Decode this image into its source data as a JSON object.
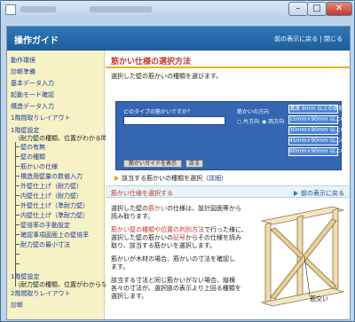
{
  "window": {
    "minimize_glyph": "–",
    "maximize_glyph": "□",
    "close_glyph": "✕"
  },
  "header": {
    "title": "操作ガイド",
    "back_link": "前の表示に戻る",
    "separator": "|",
    "close_link": "閉じる"
  },
  "sidebar": {
    "items": [
      {
        "label": "動作環境"
      },
      {
        "label": "診断準備"
      },
      {
        "label": "基本データ入力"
      },
      {
        "label": "起動モード確認"
      },
      {
        "label": "構造データ入力"
      },
      {
        "label": "1階間取りレイアウト"
      },
      {
        "label": "1階壁設定"
      },
      {
        "label": "（耐力壁の種類、位置がわかる時）"
      },
      {
        "label": "壁の有無"
      },
      {
        "label": "壁の種類"
      },
      {
        "label": "筋かいの仕様"
      },
      {
        "label": "構造用壁量の数値入力"
      },
      {
        "label": "外壁仕上げ（耐力壁）"
      },
      {
        "label": "内壁仕上げ（耐力壁）"
      },
      {
        "label": "外壁仕上げ（準耐力壁）"
      },
      {
        "label": "内壁仕上げ（準耐力壁）"
      },
      {
        "label": "壁倍率の手動設定"
      },
      {
        "label": "確認事項図面上の壁倍率"
      },
      {
        "label": "耐力壁の最小寸法"
      },
      {
        "label": "1階壁設定"
      },
      {
        "label": "（耐力壁の種類、位置がわからない時）"
      },
      {
        "label": "2階間取りレイアウト"
      },
      {
        "label": "診断"
      }
    ]
  },
  "main": {
    "section_title": "筋かい仕様の選択方法",
    "intro": "選択した壁の筋かいの種類を選びます。",
    "panel": {
      "question": "どのタイプの筋かいですか？",
      "direction_label": "筋かいの方向",
      "radio_one": "片方向",
      "radio_both": "両方向",
      "type_buttons": [
        "溝渡 9mm 以上の鉄筋",
        "15mm×90mm 以上の鉄筋",
        "30mm×90mm 以上の鉄筋",
        "45mm×90mm 以上の鉄筋",
        "90mm×90mm 以上の鉄筋"
      ],
      "guide_button": "筋かいガイドを表示",
      "return_button": "戻る"
    },
    "note": "該当する筋かいの種類を選択（",
    "note_link": "詳細",
    "note_end": "）",
    "sub_title": "筋かい仕様を選択する",
    "sub_back": "前の表示に戻る",
    "para1_a": "選択した壁の",
    "para1_hl": "筋かい",
    "para1_b": "の仕様は、設計図面等から",
    "para1_c": "読み取ります。",
    "para2_a": "筋かい壁の種類や位置の判別方法",
    "para2_b": "で行った様に、",
    "para2_c": "選択した壁の筋かいの",
    "para2_hl": "記号",
    "para2_d": "からその仕様を読み",
    "para2_e": "取り、該当する筋かいを選択します。",
    "para3_a": "筋かいが木材の場合、筋かいの寸法を確認し",
    "para3_b": "ます。",
    "para4_a": "該当する寸法と同じ筋かいがない場合、縦横",
    "para4_b": "各々の寸法が、選択肢の表示より上回る種類を",
    "para4_c": "選択します。",
    "diagram_label": "筋交い"
  },
  "colors": {
    "header_bg": "#2f77b8",
    "sidebar_bg": "#f6f2c6",
    "accent_red": "#c0392b",
    "link_blue": "#1a3a9c",
    "panel_bg": "#3566b2",
    "section_rule": "#e3b128"
  }
}
